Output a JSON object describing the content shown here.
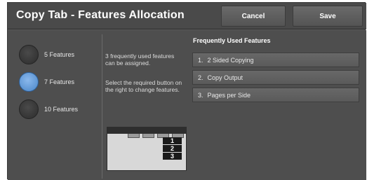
{
  "header": {
    "title": "Copy Tab - Features Allocation",
    "cancel_label": "Cancel",
    "save_label": "Save"
  },
  "options": [
    {
      "label": "5 Features",
      "selected": false
    },
    {
      "label": "7 Features",
      "selected": true
    },
    {
      "label": "10 Features",
      "selected": false
    }
  ],
  "description": {
    "line1": "3 frequently used features can be assigned.",
    "line2": "Select the required button on the right to change features."
  },
  "diagram": {
    "numbers": [
      "1",
      "2",
      "3"
    ]
  },
  "frequently_used": {
    "title": "Frequently Used Features",
    "items": [
      {
        "num": "1.",
        "label": "2 Sided Copying"
      },
      {
        "num": "2.",
        "label": "Copy Output"
      },
      {
        "num": "3.",
        "label": "Pages per Side"
      }
    ]
  },
  "colors": {
    "selected_radio": "#5b95d6",
    "panel": "#4e4e4e"
  }
}
